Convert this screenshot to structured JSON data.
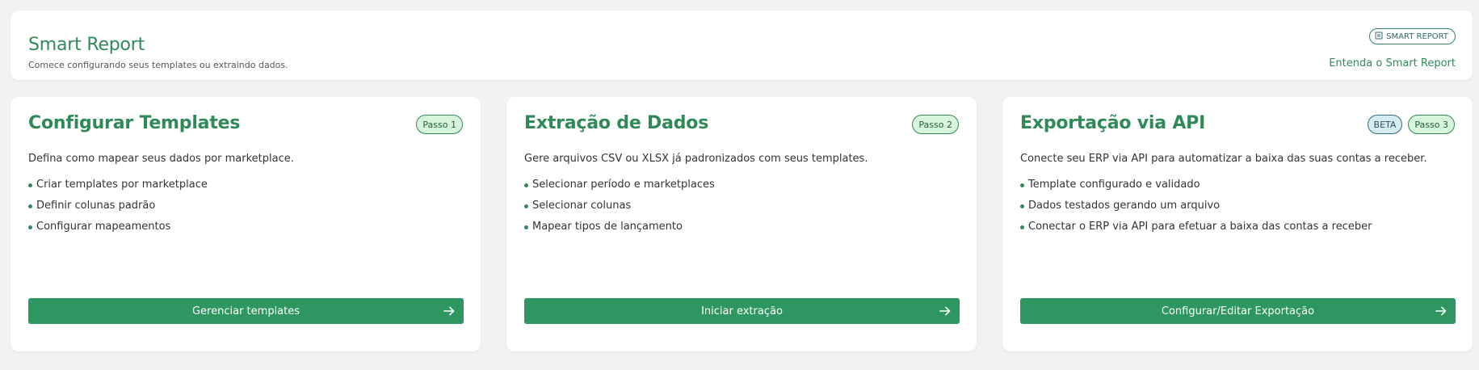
{
  "header": {
    "title": "Smart Report",
    "subtitle": "Comece configurando seus templates ou extraindo dados.",
    "badge_label": "SMART REPORT",
    "badge_icon": "report-icon",
    "link_label": "Entenda o Smart Report"
  },
  "cards": [
    {
      "title": "Configurar Templates",
      "badges": [
        "Passo 1"
      ],
      "description": "Defina como mapear seus dados por marketplace.",
      "items": [
        "Criar templates por marketplace",
        "Definir colunas padrão",
        "Configurar mapeamentos"
      ],
      "button_label": "Gerenciar templates"
    },
    {
      "title": "Extração de Dados",
      "badges": [
        "Passo 2"
      ],
      "description": "Gere arquivos CSV ou XLSX já padronizados com seus templates.",
      "items": [
        "Selecionar período e marketplaces",
        "Selecionar colunas",
        "Mapear tipos de lançamento"
      ],
      "button_label": "Iniciar extração"
    },
    {
      "title": "Exportação via API",
      "badges": [
        "BETA",
        "Passo 3"
      ],
      "description": "Conecte seu ERP via API para automatizar a baixa das suas contas a receber.",
      "items": [
        "Template configurado e validado",
        "Dados testados gerando um arquivo",
        "Conectar o ERP via API para efetuar a baixa das contas a receber"
      ],
      "button_label": "Configurar/Editar Exportação"
    }
  ],
  "colors": {
    "accent": "#2f8a57",
    "button": "#2e9660",
    "background": "#f2f2f2"
  }
}
